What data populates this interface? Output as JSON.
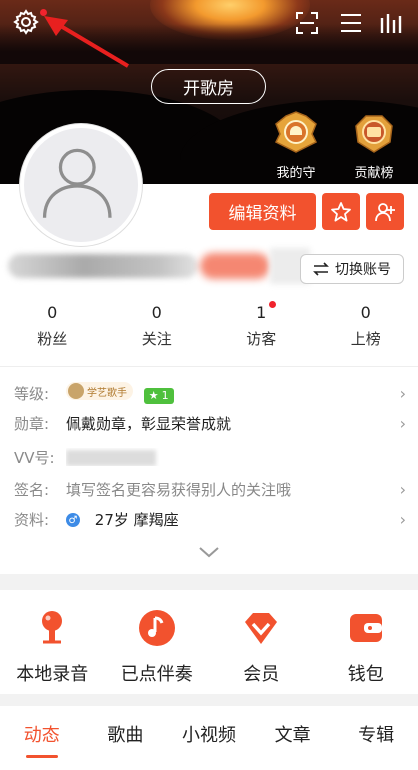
{
  "header": {
    "room_button": "开歌房",
    "badges": [
      {
        "label": "我的守护"
      },
      {
        "label": "贡献榜"
      }
    ]
  },
  "profile": {
    "edit_button": "编辑资料",
    "switch_account": "切换账号"
  },
  "stats": [
    {
      "value": "0",
      "label": "粉丝"
    },
    {
      "value": "0",
      "label": "关注"
    },
    {
      "value": "1",
      "label": "访客"
    },
    {
      "value": "0",
      "label": "上榜"
    }
  ],
  "info": {
    "level": {
      "key": "等级:",
      "badge_text": "学艺歌手",
      "level_num": "1"
    },
    "medal": {
      "key": "勋章:",
      "value": "佩戴勋章，彰显荣誉成就"
    },
    "vv": {
      "key": "VV号:"
    },
    "signature": {
      "key": "签名:",
      "value": "填写签名更容易获得别人的关注哦"
    },
    "profile": {
      "key": "资料:",
      "gender": "♂",
      "value": "27岁  摩羯座"
    }
  },
  "quick_menu": [
    {
      "label": "本地录音",
      "icon": "microphone-icon"
    },
    {
      "label": "已点伴奏",
      "icon": "music-note-icon"
    },
    {
      "label": "会员",
      "icon": "vip-diamond-icon"
    },
    {
      "label": "钱包",
      "icon": "wallet-icon"
    }
  ],
  "tabs": [
    {
      "label": "动态",
      "active": true
    },
    {
      "label": "歌曲"
    },
    {
      "label": "小视频"
    },
    {
      "label": "文章"
    },
    {
      "label": "专辑"
    }
  ],
  "colors": {
    "accent": "#f2522e",
    "notify_dot": "#f0232d",
    "level_green": "#4fc03d",
    "male_blue": "#3d8be6"
  }
}
